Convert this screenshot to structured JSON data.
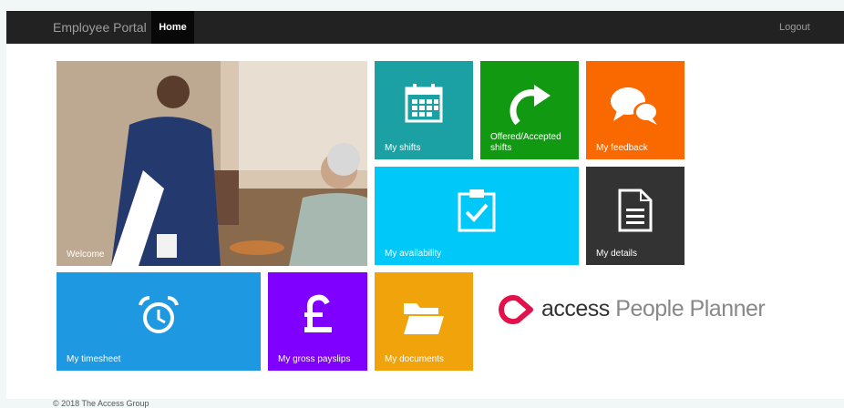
{
  "navbar": {
    "brand": "Employee Portal",
    "home": "Home",
    "logout": "Logout"
  },
  "tiles": {
    "welcome": {
      "label": "Welcome",
      "color": "#c9b29a"
    },
    "shifts": {
      "label": "My shifts",
      "color": "#1ba1a4",
      "icon": "calendar-icon"
    },
    "offered": {
      "label": "Offered/Accepted shifts",
      "color": "#119a11",
      "icon": "redo-arrow-icon"
    },
    "feedback": {
      "label": "My feedback",
      "color": "#fa6800",
      "icon": "speech-bubbles-icon"
    },
    "availability": {
      "label": "My availability",
      "color": "#00c8f8",
      "icon": "clipboard-check-icon"
    },
    "details": {
      "label": "My details",
      "color": "#333333",
      "icon": "document-icon"
    },
    "timesheet": {
      "label": "My timesheet",
      "color": "#1e98e0",
      "icon": "alarm-clock-icon"
    },
    "payslips": {
      "label": "My gross payslips",
      "color": "#8000ff",
      "icon": "pound-icon"
    },
    "documents": {
      "label": "My documents",
      "color": "#f0a30a",
      "icon": "folder-icon"
    }
  },
  "logo": {
    "brand": "access",
    "product": "People Planner",
    "color": "#e3114b"
  },
  "footer": {
    "copyright": "© 2018 The Access Group"
  }
}
